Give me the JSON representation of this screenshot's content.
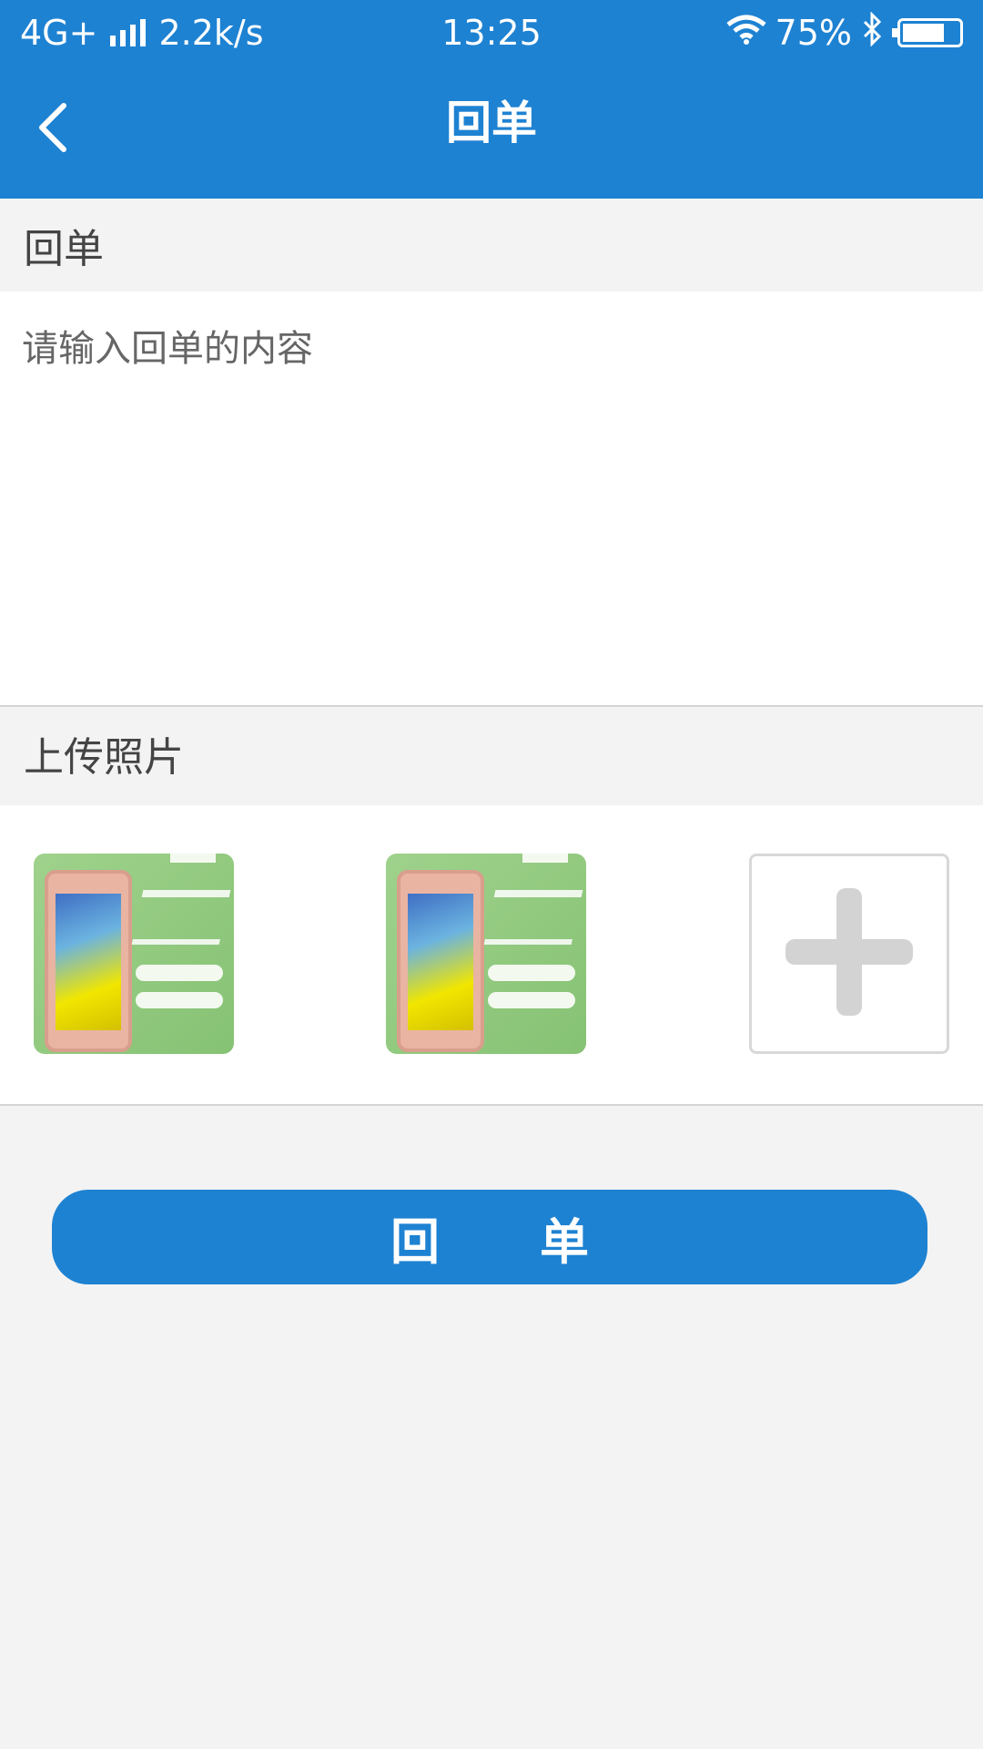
{
  "status_bar": {
    "network": "4G+",
    "speed": "2.2k/s",
    "time": "13:25",
    "battery": "75%",
    "battery_level": 0.75,
    "icons": [
      "signal-icon",
      "wifi-icon",
      "bluetooth-icon",
      "battery-icon"
    ]
  },
  "header": {
    "title": "回单",
    "back_icon": "chevron-left-icon"
  },
  "reply_section": {
    "label": "回单",
    "placeholder": "请输入回单的内容",
    "value": ""
  },
  "upload_section": {
    "label": "上传照片",
    "photos": [
      {
        "name": "photo-thumbnail-1"
      },
      {
        "name": "photo-thumbnail-2"
      }
    ],
    "add_icon": "plus-icon"
  },
  "submit": {
    "label": "回单"
  },
  "colors": {
    "primary": "#1e82d2",
    "background": "#f3f3f3",
    "divider": "#d4d4d4"
  }
}
